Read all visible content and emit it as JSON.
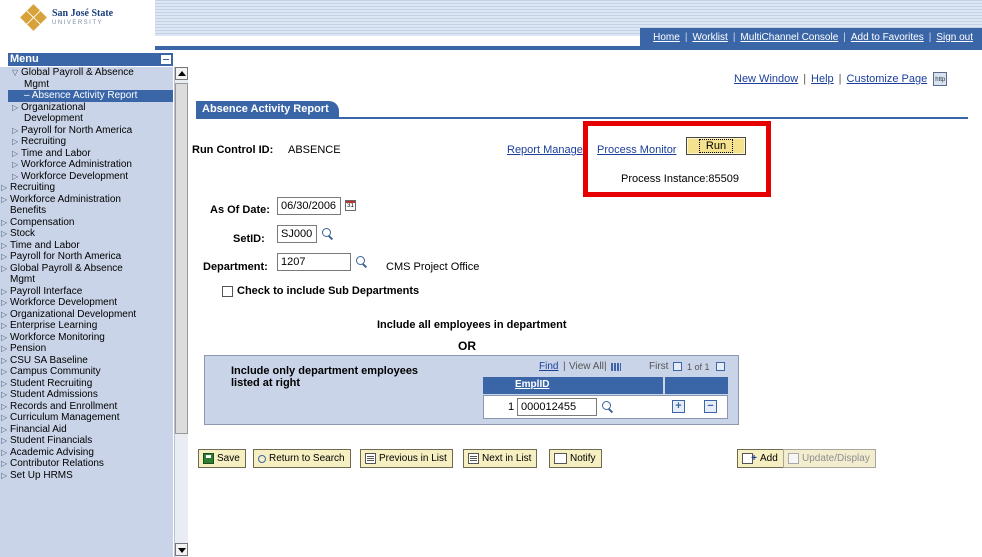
{
  "branding": {
    "name": "San José State",
    "subname": "UNIVERSITY"
  },
  "topnav": {
    "links": [
      "Home",
      "Worklist",
      "MultiChannel Console",
      "Add to Favorites",
      "Sign out"
    ]
  },
  "menu": {
    "title": "Menu",
    "items": [
      {
        "label": "Global Payroll & Absence",
        "level": 1,
        "expanded": true
      },
      {
        "label": "Mgmt",
        "level": 1,
        "continuation": true
      },
      {
        "label": "Absence Activity Report",
        "level": 2,
        "selected": true
      },
      {
        "label": "Organizational",
        "level": 1
      },
      {
        "label": "Development",
        "level": 1,
        "continuation": true
      },
      {
        "label": "Payroll for North America",
        "level": 1
      },
      {
        "label": "Recruiting",
        "level": 1
      },
      {
        "label": "Time and Labor",
        "level": 1
      },
      {
        "label": "Workforce Administration",
        "level": 1
      },
      {
        "label": "Workforce Development",
        "level": 1
      },
      {
        "label": "Recruiting",
        "level": 0
      },
      {
        "label": "Workforce Administration",
        "level": 0
      },
      {
        "label": "Benefits",
        "level": 0,
        "continuation": true
      },
      {
        "label": "Compensation",
        "level": 0
      },
      {
        "label": "Stock",
        "level": 0
      },
      {
        "label": "Time and Labor",
        "level": 0
      },
      {
        "label": "Payroll for North America",
        "level": 0
      },
      {
        "label": "Global Payroll & Absence",
        "level": 0
      },
      {
        "label": "Mgmt",
        "level": 0,
        "continuation": true
      },
      {
        "label": "Payroll Interface",
        "level": 0
      },
      {
        "label": "Workforce Development",
        "level": 0
      },
      {
        "label": "Organizational Development",
        "level": 0
      },
      {
        "label": "Enterprise Learning",
        "level": 0
      },
      {
        "label": "Workforce Monitoring",
        "level": 0
      },
      {
        "label": "Pension",
        "level": 0
      },
      {
        "label": "CSU SA Baseline",
        "level": 0
      },
      {
        "label": "Campus Community",
        "level": 0
      },
      {
        "label": "Student Recruiting",
        "level": 0
      },
      {
        "label": "Student Admissions",
        "level": 0
      },
      {
        "label": "Records and Enrollment",
        "level": 0
      },
      {
        "label": "Curriculum Management",
        "level": 0
      },
      {
        "label": "Financial Aid",
        "level": 0
      },
      {
        "label": "Student Financials",
        "level": 0
      },
      {
        "label": "Academic Advising",
        "level": 0
      },
      {
        "label": "Contributor Relations",
        "level": 0
      },
      {
        "label": "Set Up HRMS",
        "level": 0
      }
    ]
  },
  "util_links": {
    "new_window": "New Window",
    "help": "Help",
    "customize": "Customize Page",
    "http_icon": "http"
  },
  "page": {
    "tab_title": "Absence Activity Report",
    "run_control_label": "Run Control ID:",
    "run_control_value": "ABSENCE",
    "report_manager": "Report Manage",
    "process_monitor": "Process Monitor",
    "run_button": "Run",
    "process_instance": "Process Instance:85509",
    "as_of_date_label": "As Of Date:",
    "as_of_date_value": "06/30/2006",
    "calendar_icon_text": "31",
    "setid_label": "SetID:",
    "setid_value": "SJ000",
    "department_label": "Department:",
    "department_value": "1207",
    "department_desc": "CMS Project Office",
    "sub_dept_checkbox": "Check to include Sub Departments",
    "include_all": "Include all employees in department",
    "or_text": "OR",
    "include_only_line1": "Include only department employees",
    "include_only_line2": "listed at right"
  },
  "grid": {
    "find": "Find",
    "view_all": "View All",
    "first": "First",
    "range": "1 of 1",
    "column": "EmplID",
    "rows": [
      {
        "num": "1",
        "emplid": "000012455"
      }
    ],
    "add_row": "+",
    "delete_row": "−"
  },
  "toolbar": {
    "save": "Save",
    "return_to_search": "Return to Search",
    "previous_in_list": "Previous in List",
    "next_in_list": "Next in List",
    "notify": "Notify",
    "add": "Add",
    "update_display": "Update/Display"
  },
  "colors": {
    "accent": "#3a66a8",
    "menu_bg": "#c9d4e8",
    "highlight": "#e60000",
    "button_bg": "#f6efc2"
  }
}
